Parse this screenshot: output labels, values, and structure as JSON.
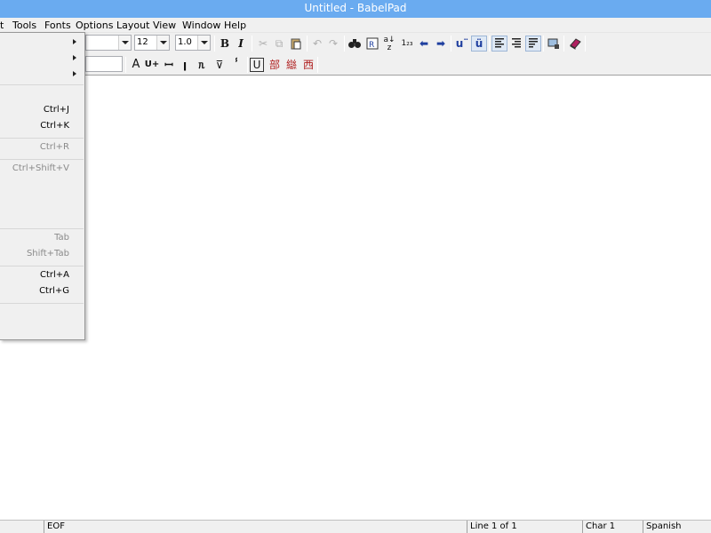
{
  "window": {
    "title": "Untitled - BabelPad"
  },
  "menubar": {
    "items": [
      {
        "label": "t"
      },
      {
        "label": "Tools"
      },
      {
        "label": "Fonts"
      },
      {
        "label": "Options"
      },
      {
        "label": "Layout"
      },
      {
        "label": "View"
      },
      {
        "label": "Window"
      },
      {
        "label": "Help"
      }
    ]
  },
  "toolbar": {
    "font_size": "12",
    "line_spacing": "1.0",
    "icons": [
      "bold-icon",
      "italic-icon",
      "cut-icon",
      "copy-icon",
      "paste-icon",
      "undo-icon",
      "redo-icon",
      "find-icon",
      "replace-icon",
      "sort-icon",
      "number-icon",
      "back-arrow-icon",
      "forward-arrow-icon",
      "combining-diaeresis-icon",
      "u-umlaut-icon",
      "align-left-icon",
      "align-right-icon",
      "justify-icon",
      "print-icon",
      "book-icon"
    ],
    "labels": {
      "bold": "B",
      "italic": "I",
      "combining": "u¨",
      "umlaut": "ü",
      "underline_box": "U"
    }
  },
  "edit_menu": {
    "shortcuts": {
      "ctrl_j": "Ctrl+J",
      "ctrl_k": "Ctrl+K",
      "ctrl_r": "Ctrl+R",
      "ctrl_shift_v": "Ctrl+Shift+V",
      "tab": "Tab",
      "shift_tab": "Shift+Tab",
      "ctrl_a": "Ctrl+A",
      "ctrl_g": "Ctrl+G"
    }
  },
  "statusbar": {
    "position": "EOF",
    "line": "Line 1 of 1",
    "char": "Char 1",
    "language": "Spanish (Spain)"
  },
  "colors": {
    "titlebar": "#6aabf0",
    "chrome": "#f0f0f0",
    "accent_blue": "#1f3f9f",
    "accent_red": "#b02020"
  }
}
